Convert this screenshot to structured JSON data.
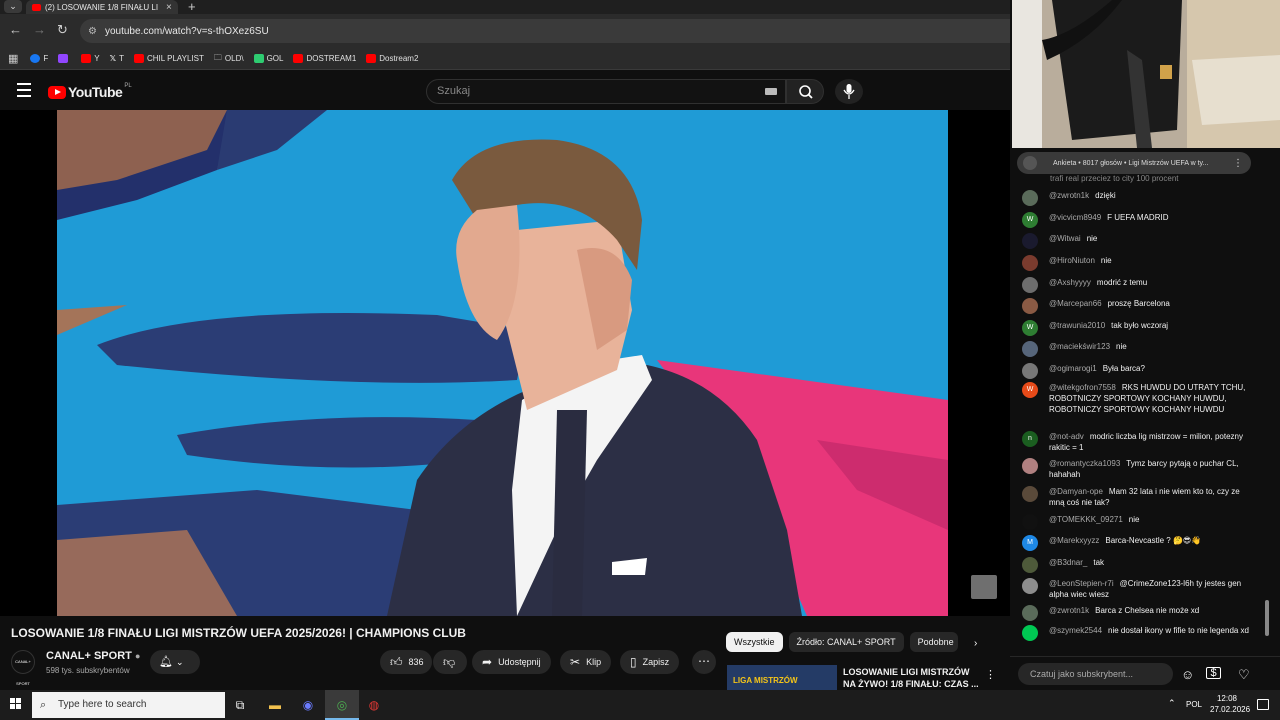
{
  "browser": {
    "tab_title": "(2) LOSOWANIE 1/8 FINAŁU LI",
    "url": "youtube.com/watch?v=s-thOXez6SU",
    "bookmarks": [
      {
        "label": "F",
        "color": "#1877f2"
      },
      {
        "label": "",
        "color": "#9146ff"
      },
      {
        "label": "Y",
        "color": "#ff0000"
      },
      {
        "label": "T",
        "color": "#ffffff"
      },
      {
        "label": "CHIL PLAYLIST",
        "color": "#ff0000"
      },
      {
        "label": "OLD\\",
        "color": "folder"
      },
      {
        "label": "GOL",
        "color": "#2ecc71"
      },
      {
        "label": "DOSTREAM1",
        "color": "#ff0000"
      },
      {
        "label": "Dostream2",
        "color": "#ff0000"
      }
    ]
  },
  "youtube": {
    "logo": "YouTube",
    "region": "PL",
    "search_placeholder": "Szukaj"
  },
  "video": {
    "title": "LOSOWANIE 1/8 FINAŁU LIGI MISTRZÓW UEFA 2025/2026! | CHAMPIONS CLUB",
    "channel_name": "CANAL+ SPORT",
    "channel_subs": "598 tys. subskrybentów",
    "channel_avatar_text": "CANAL+ SPORT",
    "likes": "836",
    "share_label": "Udostępnij",
    "clip_label": "Klip",
    "save_label": "Zapisz"
  },
  "chips": [
    "Wszystkie",
    "Źródło: CANAL+ SPORT",
    "Podobne"
  ],
  "recommendation": {
    "thumb_label": "LIGA MISTRZÓW",
    "title": "LOSOWANIE LIGI MISTRZÓW NA ŻYWO! 1/8 FINAŁU: CZAS ..."
  },
  "chat": {
    "poll_text": "Ankieta • 8017 głosów • Ligi Mistrzów UEFA w ty...",
    "pinned_partial": "trafi real przeciez to city 100 procent",
    "input_placeholder": "Czatuj jako subskrybent...",
    "messages": [
      {
        "author": "@zwrotn1k",
        "text": "dzięki",
        "avatar": "",
        "color": "#5a6b5a"
      },
      {
        "author": "@vicvicm8949",
        "text": "F UEFA MADRID",
        "avatar": "W",
        "color": "#2e7d32"
      },
      {
        "author": "@Witwai",
        "text": "nie",
        "avatar": "",
        "color": "#1a1a2e"
      },
      {
        "author": "@HiroNiuton",
        "text": "nie",
        "avatar": "",
        "color": "#7a3b2e"
      },
      {
        "author": "@Axshyyyy",
        "text": "modrić z temu",
        "avatar": "",
        "color": "#6d6d6d"
      },
      {
        "author": "@Marcepan66",
        "text": "proszę Barcelona",
        "avatar": "",
        "color": "#8a5a44"
      },
      {
        "author": "@trawunia2010",
        "text": "tak było wczoraj",
        "avatar": "W",
        "color": "#2e7d32"
      },
      {
        "author": "@maciekświr123",
        "text": "nie",
        "avatar": "",
        "color": "#56657a"
      },
      {
        "author": "@ogimarogi1",
        "text": "Była barca?",
        "avatar": "",
        "color": "#777777"
      },
      {
        "author": "@witekgofron7558",
        "text": "RKS HUWDU DO UTRATY TCHU, ROBOTNICZY SPORTOWY KOCHANY HUWDU, ROBOTNICZY SPORTOWY KOCHANY HUWDU",
        "avatar": "W",
        "color": "#e64a19"
      },
      {
        "author": "@not-adv",
        "text": "modric liczba lig mistrzow = milion, potezny rakitic = 1",
        "avatar": "n",
        "color": "#1b5e20"
      },
      {
        "author": "@romantyczka1093",
        "text": "Tymz barcy pytają o puchar CL, hahahah",
        "avatar": "",
        "color": "#b08080"
      },
      {
        "author": "@Damyan-ope",
        "text": "Mam 32 lata i nie wiem kto to, czy ze mną coś nie tak?",
        "avatar": "",
        "color": "#5a4a3a"
      },
      {
        "author": "@TOMEKKK_09271",
        "text": "nie",
        "avatar": "",
        "color": "#111111"
      },
      {
        "author": "@Marekxyyzz",
        "text": "Barca-Nevcastle ? 🤔😎👋",
        "avatar": "M",
        "color": "#1e88e5"
      },
      {
        "author": "@B3dnar_",
        "text": "tak",
        "avatar": "",
        "color": "#4e5a3a"
      },
      {
        "author": "@LeonStepien-r7i",
        "text": "@CrimeZone123-l6h ty jestes gen alpha wiec wiesz",
        "avatar": "",
        "color": "#8d8d8d"
      },
      {
        "author": "@zwrotn1k",
        "text": "Barca z Chelsea nie może xd",
        "avatar": "",
        "color": "#5a6b5a"
      },
      {
        "author": "@szymek2544",
        "text": "nie dostał ikony w fifie to nie legenda xd",
        "avatar": "",
        "color": "#00c853"
      }
    ]
  },
  "taskbar": {
    "search_placeholder": "Type here to search",
    "lang": "POL",
    "time": "12:08",
    "date": "27.02.2026"
  }
}
